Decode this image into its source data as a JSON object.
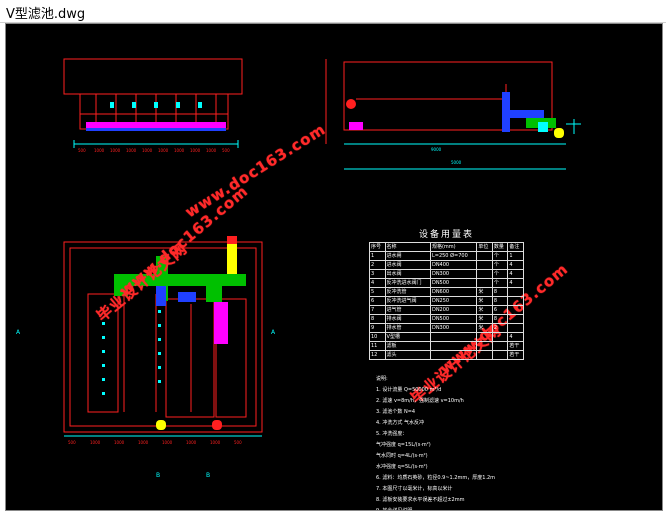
{
  "window": {
    "title": "V型滤池.dwg"
  },
  "watermarks": [
    {
      "text": "毕业设计论文网",
      "color": "#ff2a2a"
    },
    {
      "text": "www.doc163.com",
      "color": "#ff2a2a"
    }
  ],
  "equipment_table": {
    "title": "设备用量表",
    "headers": [
      "序号",
      "名称",
      "规格(mm)",
      "单位",
      "数量",
      "备注"
    ],
    "rows": [
      [
        "1",
        "进水闸",
        "L=250 Ø=700",
        "",
        "个",
        "1"
      ],
      [
        "2",
        "进水阀",
        "DN400",
        "",
        "个",
        "4"
      ],
      [
        "3",
        "出水阀",
        "DN300",
        "",
        "个",
        "4"
      ],
      [
        "4",
        "反冲洗进水阀门",
        "DN500",
        "",
        "个",
        "4"
      ],
      [
        "5",
        "反冲洗管",
        "DN600",
        "米",
        "8",
        ""
      ],
      [
        "6",
        "反冲洗进气阀",
        "DN250",
        "米",
        "8",
        ""
      ],
      [
        "7",
        "进气管",
        "DN200",
        "米",
        "6",
        ""
      ],
      [
        "8",
        "排水阀",
        "DN500",
        "米",
        "8",
        ""
      ],
      [
        "9",
        "排水管",
        "DN300",
        "米",
        "2",
        ""
      ],
      [
        "10",
        "V型槽",
        "",
        "",
        "",
        "4"
      ],
      [
        "11",
        "滤板",
        "",
        "",
        "",
        "若干"
      ],
      [
        "12",
        "滤头",
        "",
        "",
        "",
        "若干"
      ]
    ]
  },
  "notes": [
    "说明:",
    "1. 设计流量 Q=50000 m³/d",
    "2. 滤速 v=8m/h，强制滤速 v=10m/h",
    "3. 滤池个数 N=4",
    "4. 冲洗方式 气水反冲",
    "5. 冲洗强度：",
    "   气冲强度 q=15L/(s·m²)",
    "   气水同时 q=4L/(s·m²)",
    "   水冲强度 q=5L/(s·m²)",
    "6. 滤料：均质石英砂，粒径0.9~1.2mm，厚度1.2m",
    "7. 本图尺寸以毫米计，标高以米计",
    "8. 滤板安装要求水平误差不超过±2mm",
    "9. 其余详见说明"
  ],
  "dims": {
    "top_dim": "5000",
    "side_dim": "9000",
    "plan_dims": [
      "500",
      "1000",
      "1000",
      "1000",
      "1000",
      "1000",
      "1000",
      "1000",
      "1000",
      "500"
    ],
    "sec_dims": [
      "500",
      "1000",
      "1000",
      "1000",
      "1000",
      "1000",
      "1000",
      "500"
    ]
  },
  "colors": {
    "line": "#ff2020",
    "cyan": "#00ffff",
    "green": "#00c000",
    "blue": "#2040ff",
    "yellow": "#ffff00",
    "magenta": "#ff00ff"
  }
}
